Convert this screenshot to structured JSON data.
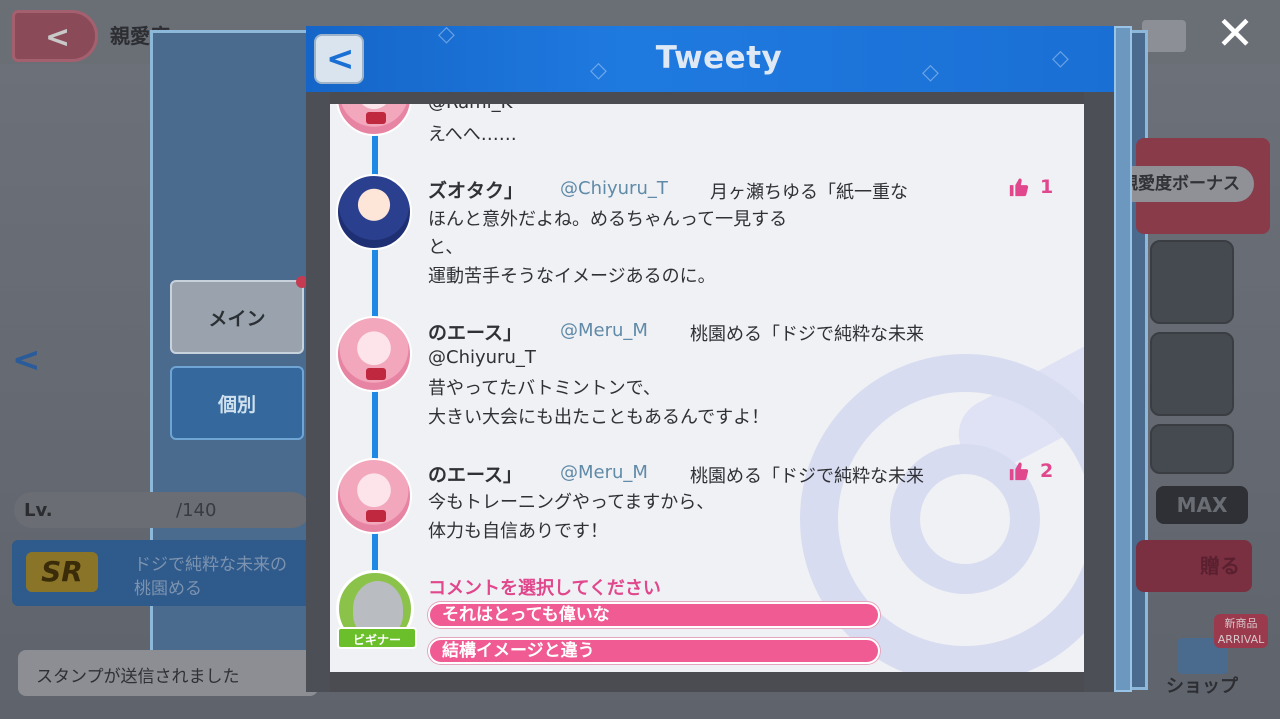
{
  "background": {
    "screen_title": "親愛度",
    "tabs": {
      "main": "メイン",
      "individual": "個別"
    },
    "level": {
      "label": "Lv.",
      "value": "/140"
    },
    "card": {
      "rarity": "SR",
      "title_line1": "ドジで純粋な未来の",
      "title_line2": "桃園める"
    },
    "bonus_label": "親愛度ボーナス",
    "max_label": "MAX",
    "red_button_label": "贈る",
    "toast": "スタンプが送信されました",
    "shop": {
      "badge_line1": "新商品",
      "badge_line2": "ARRIVAL",
      "label": "ショップ"
    }
  },
  "modal": {
    "title": "Tweety",
    "close_icon": "close-icon",
    "back_icon": "chevron-left-icon"
  },
  "feed": {
    "partial_tweet": {
      "handle": "@Rami_K",
      "body": "えへへ……"
    },
    "tweets": [
      {
        "author": "ズオタク」",
        "handle": "@Chiyuru_T",
        "character": "月ヶ瀬ちゆる「紙一重な",
        "lines": [
          "ほんと意外だよね。めるちゃんって一見する",
          "と、",
          "運動苦手そうなイメージあるのに。"
        ],
        "likes": "1"
      },
      {
        "author": "のエース」",
        "handle": "@Meru_M",
        "character": "桃園める「ドジで純粋な未来",
        "lines": [
          "@Chiyuru_T",
          "昔やってたバトミントンで、",
          "大きい大会にも出たこともあるんですよ！"
        ],
        "likes": ""
      },
      {
        "author": "のエース」",
        "handle": "@Meru_M",
        "character": "桃園める「ドジで純粋な未来",
        "lines": [
          "今もトレーニングやってますから、",
          "体力も自信ありです！"
        ],
        "likes": "2"
      }
    ],
    "reply": {
      "badge": "ビギナー",
      "prompt": "コメントを選択してください",
      "choices": [
        "それはとっても偉いな",
        "結構イメージと違う"
      ]
    }
  },
  "colors": {
    "accent": "#1e88e5",
    "like": "#e0478c",
    "choice": "#ef5b92"
  }
}
